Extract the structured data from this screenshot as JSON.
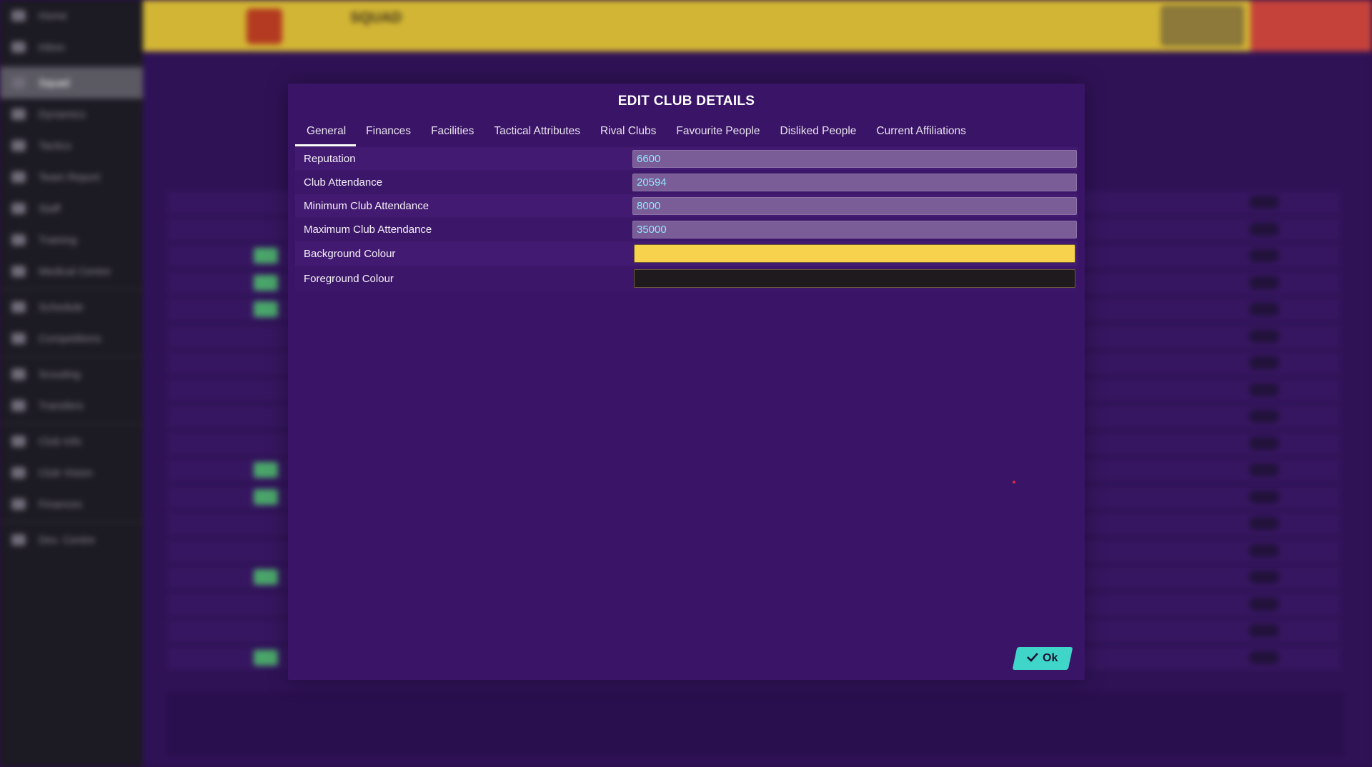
{
  "modal": {
    "title": "EDIT CLUB DETAILS",
    "tabs": [
      {
        "label": "General",
        "active": true
      },
      {
        "label": "Finances",
        "active": false
      },
      {
        "label": "Facilities",
        "active": false
      },
      {
        "label": "Tactical Attributes",
        "active": false
      },
      {
        "label": "Rival Clubs",
        "active": false
      },
      {
        "label": "Favourite People",
        "active": false
      },
      {
        "label": "Disliked People",
        "active": false
      },
      {
        "label": "Current Affiliations",
        "active": false
      }
    ],
    "fields": [
      {
        "label": "Reputation",
        "value": "6600"
      },
      {
        "label": "Club Attendance",
        "value": "20594"
      },
      {
        "label": "Minimum Club Attendance",
        "value": "8000"
      },
      {
        "label": "Maximum Club Attendance",
        "value": "35000"
      }
    ],
    "colours": [
      {
        "label": "Background Colour",
        "color": "#f7d24d"
      },
      {
        "label": "Foreground Colour",
        "color": "#1e1a1e"
      }
    ],
    "ok_label": "Ok"
  },
  "background": {
    "sidebar": [
      "Home",
      "Inbox",
      "Squad",
      "Dynamics",
      "Tactics",
      "Team Report",
      "Staff",
      "Training",
      "Medical Centre",
      "Schedule",
      "Competitions",
      "Scouting",
      "Transfers",
      "Club Info",
      "Club Vision",
      "Finances",
      "Dev. Centre"
    ],
    "topbar_title": "SQUAD",
    "accent": "#d2b534",
    "modal_bg": "#3a1466",
    "ok_color": "#3fd6c9"
  }
}
